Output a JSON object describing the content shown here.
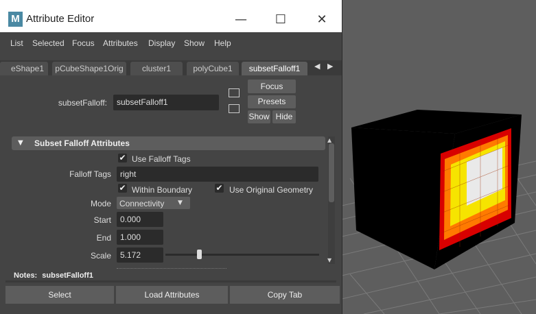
{
  "window": {
    "title": "Attribute Editor",
    "icon_letter": "M",
    "minimize": "—",
    "maximize": "☐",
    "close": "✕"
  },
  "menu": [
    "List",
    "Selected",
    "Focus",
    "Attributes",
    "Display",
    "Show",
    "Help"
  ],
  "tabs": [
    "eShape1",
    "pCubeShape1Orig",
    "cluster1",
    "polyCube1",
    "subsetFalloff1"
  ],
  "active_tab": "subsetFalloff1",
  "tab_nav": {
    "prev": "◀",
    "next": "▶"
  },
  "node": {
    "label": "subsetFalloff:",
    "name": "subsetFalloff1"
  },
  "side_buttons": {
    "focus": "Focus",
    "presets": "Presets",
    "show": "Show",
    "hide": "Hide"
  },
  "section": {
    "title": "Subset Falloff Attributes",
    "toggle": "▼"
  },
  "attrs": {
    "use_falloff_tags": {
      "label": "Use Falloff Tags",
      "checked": true
    },
    "falloff_tags": {
      "label": "Falloff Tags",
      "value": "right"
    },
    "within_boundary": {
      "label": "Within Boundary",
      "checked": true
    },
    "use_original_geometry": {
      "label": "Use Original Geometry",
      "checked": true
    },
    "mode": {
      "label": "Mode",
      "value": "Connectivity"
    },
    "start": {
      "label": "Start",
      "value": "0.000"
    },
    "end": {
      "label": "End",
      "value": "1.000"
    },
    "scale": {
      "label": "Scale",
      "value": "5.172",
      "slider_fraction": 0.22
    }
  },
  "checkmark": "✔",
  "notes": {
    "label": "Notes:",
    "value": "subsetFalloff1"
  },
  "bottom_buttons": {
    "select": "Select",
    "load": "Load Attributes",
    "copy": "Copy Tab"
  },
  "colors": {
    "cube": "#000000",
    "falloff_outer": "#d80000",
    "falloff_mid": "#ff7a00",
    "falloff_inner": "#f6e400",
    "falloff_core": "#e9e9e9",
    "grid": "#8a8a8a"
  }
}
